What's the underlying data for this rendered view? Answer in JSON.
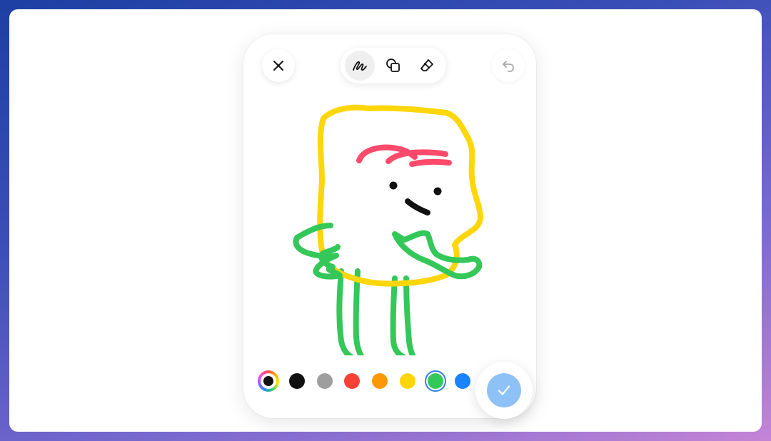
{
  "toolbar": {
    "close_icon": "close-icon",
    "tools": [
      {
        "name": "pen",
        "icon": "pen-scribble-icon",
        "active": true
      },
      {
        "name": "shapes",
        "icon": "shapes-icon",
        "active": false
      },
      {
        "name": "eraser",
        "icon": "eraser-icon",
        "active": false
      }
    ],
    "undo_icon": "undo-icon"
  },
  "palette": {
    "custom_color_icon": "color-wheel-icon",
    "selected_color": "#34c759",
    "colors": [
      "#111111",
      "#9e9e9e",
      "#f44336",
      "#ff9800",
      "#ffd60a",
      "#34c759",
      "#1a84ff"
    ]
  },
  "done_button": {
    "icon": "checkmark-icon",
    "color": "#8ec2f7"
  },
  "drawing": {
    "stroke_colors": {
      "body": "#ffd60a",
      "hair": "#ff4a6b",
      "limbs": "#34c759",
      "face": "#111111"
    }
  }
}
